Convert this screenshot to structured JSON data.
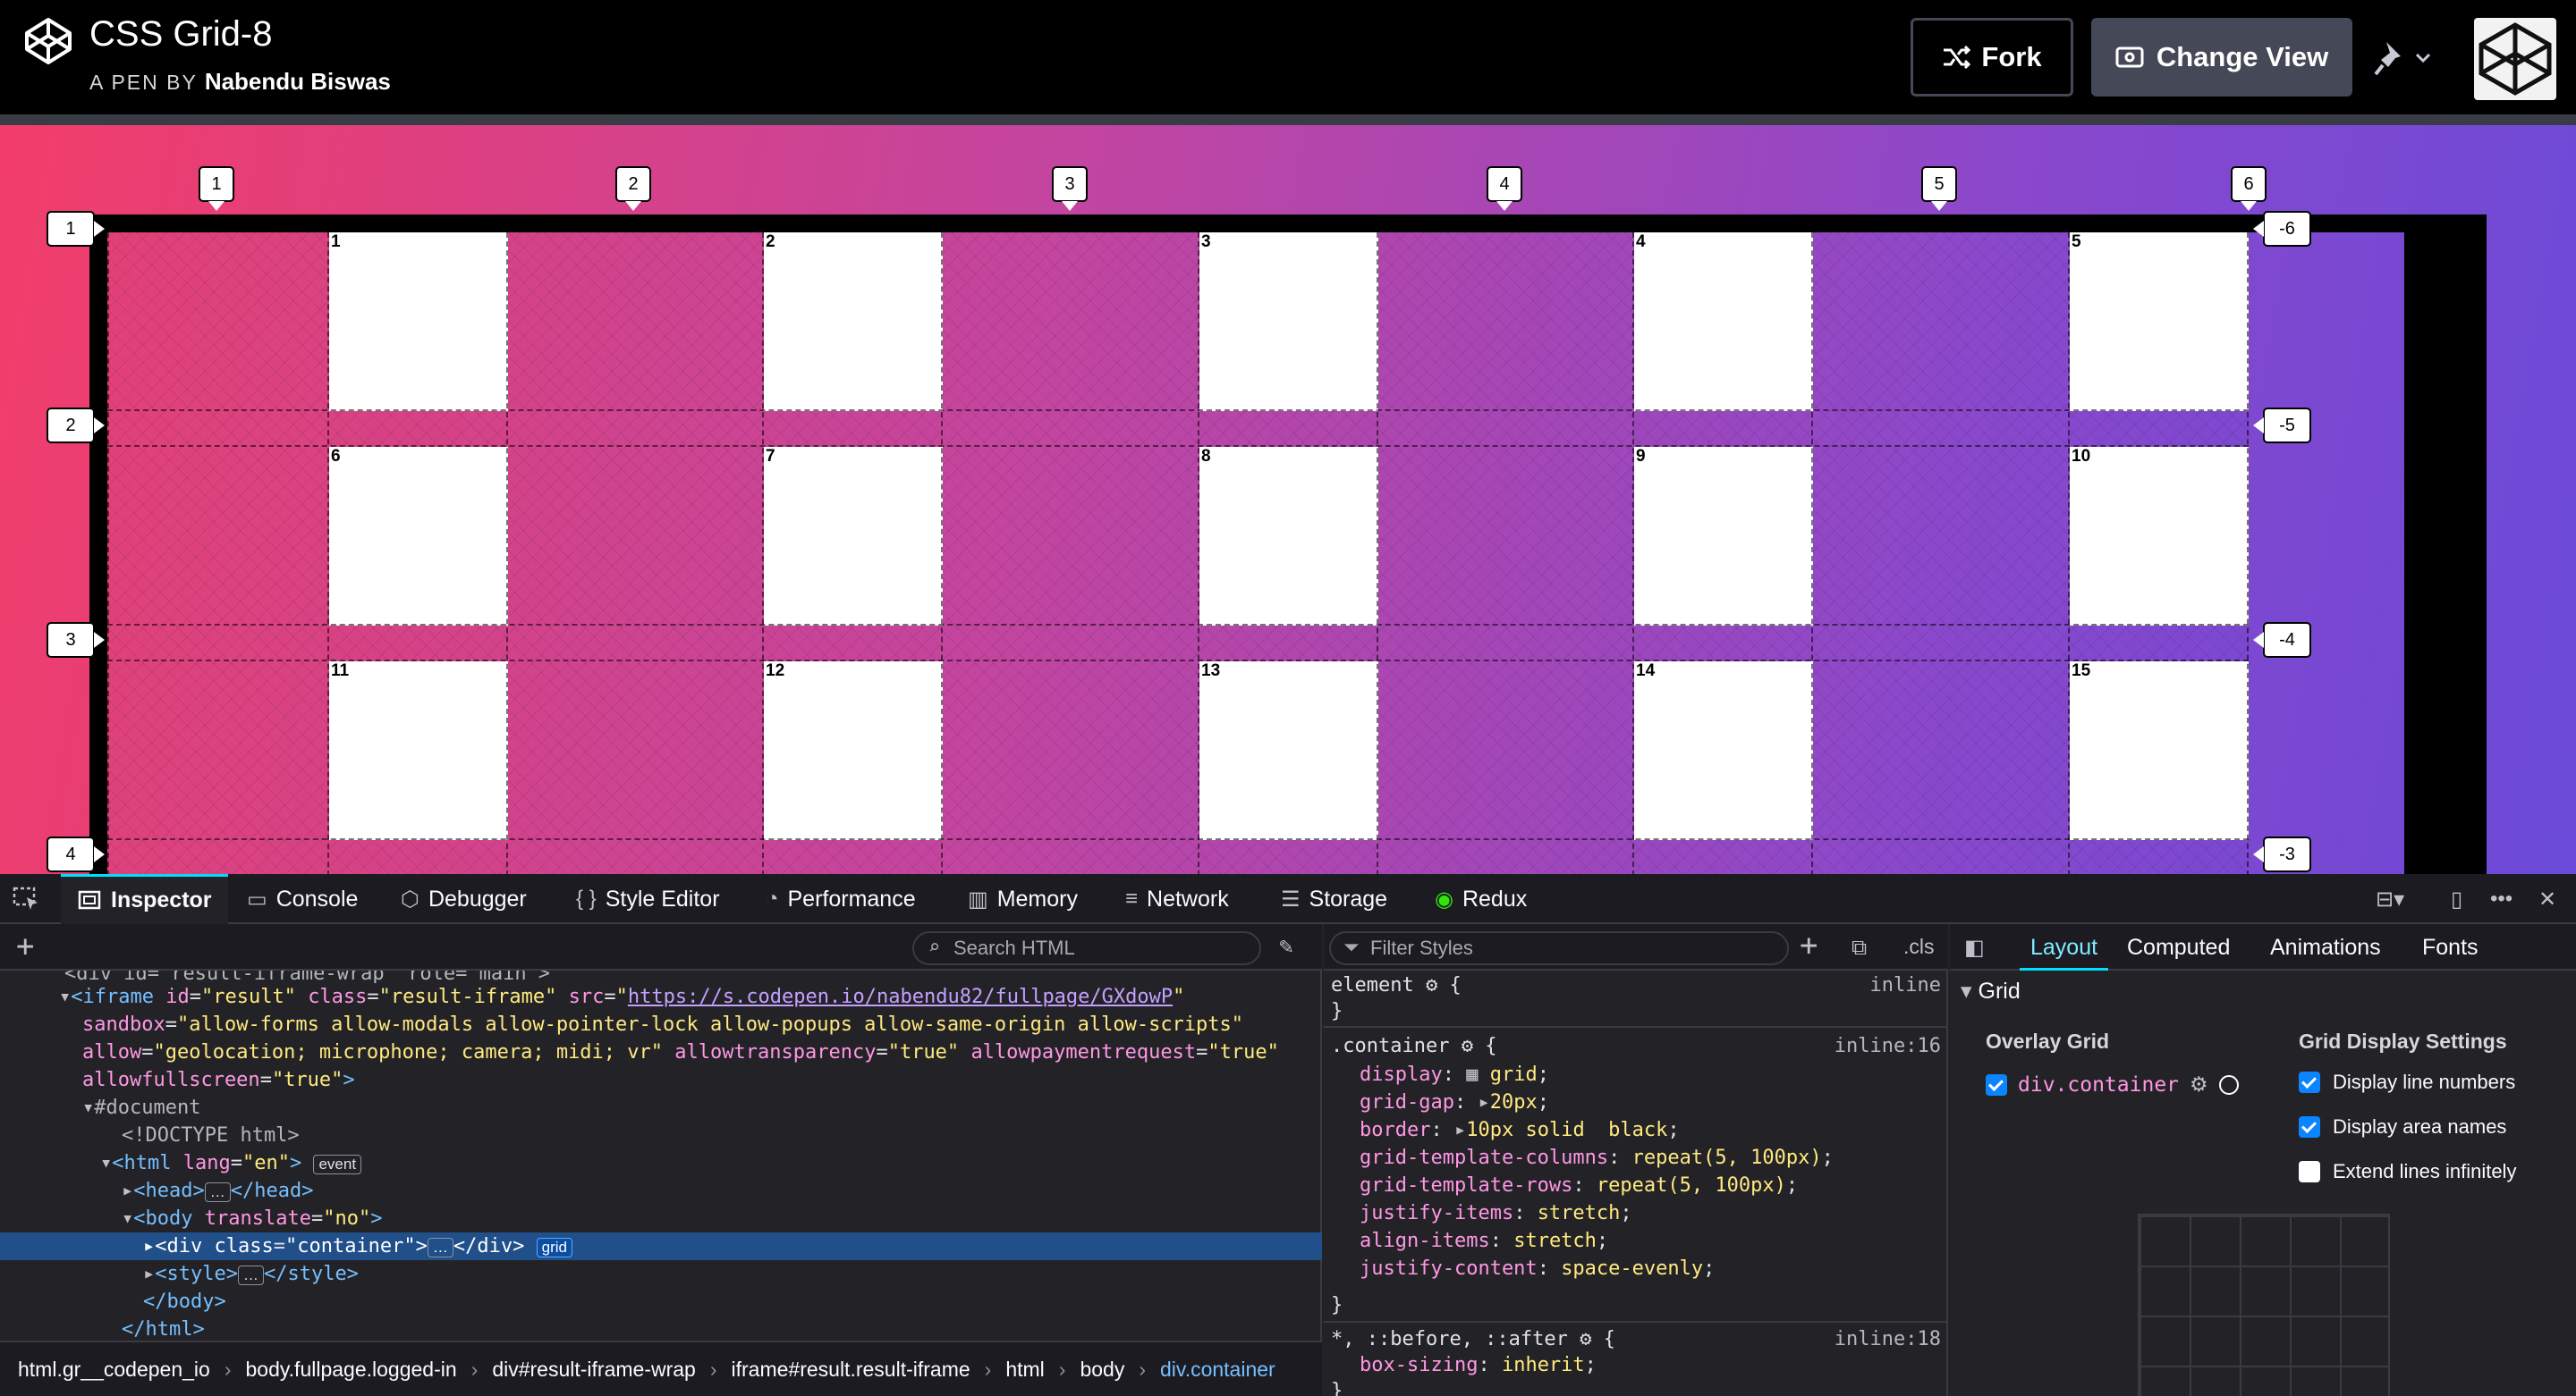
{
  "header": {
    "pen_title": "CSS Grid-8",
    "pen_by": "A PEN BY",
    "author": "Nabendu Biswas",
    "fork_label": "Fork",
    "change_view_label": "Change View"
  },
  "preview": {
    "top_line_numbers": [
      "1",
      "2",
      "3",
      "4",
      "5",
      "6"
    ],
    "left_line_numbers": [
      "1",
      "2",
      "3",
      "4"
    ],
    "right_line_numbers": [
      "-6",
      "-5",
      "-4",
      "-3"
    ],
    "cells": [
      "1",
      "2",
      "3",
      "4",
      "5",
      "6",
      "7",
      "8",
      "9",
      "10",
      "11",
      "12",
      "13",
      "14",
      "15"
    ]
  },
  "devtools": {
    "tabs": [
      "Inspector",
      "Console",
      "Debugger",
      "Style Editor",
      "Performance",
      "Memory",
      "Network",
      "Storage",
      "Redux"
    ],
    "search_html_placeholder": "Search HTML",
    "filter_styles_placeholder": "Filter Styles",
    "cls_label": ".cls",
    "markup": {
      "line0": "<div id=\"result-iframe-wrap\" role=\"main\">",
      "iframe_id": "\"result\"",
      "iframe_class": "\"result-iframe\"",
      "iframe_src": "https://s.codepen.io/nabendu82/fullpage/GXdowP",
      "sandbox": "\"allow-forms allow-modals allow-pointer-lock allow-popups allow-same-origin allow-scripts\"",
      "allow": "\"geolocation; microphone; camera; midi; vr\"",
      "allowtransparency": "\"true\"",
      "allowpaymentrequest": "\"true\"",
      "allowfullscreen": "\"true\"",
      "document": "#document",
      "doctype": "<!DOCTYPE html>",
      "html_lang": "\"en\"",
      "event_badge": "event",
      "grid_badge": "grid",
      "body_translate": "\"no\"",
      "div_class": "\"container\""
    },
    "breadcrumbs": [
      "html.gr__codepen_io",
      "body.fullpage.logged-in",
      "div#result-iframe-wrap",
      "iframe#result.result-iframe",
      "html",
      "body",
      "div.container"
    ],
    "rules": {
      "element_selector": "element",
      "element_source": "inline",
      "container_selector": ".container",
      "container_source": "inline:16",
      "decls": [
        {
          "p": "display",
          "v": "grid"
        },
        {
          "p": "grid-gap",
          "v": "20px"
        },
        {
          "p": "border",
          "v": "10px solid  black"
        },
        {
          "p": "grid-template-columns",
          "v": "repeat(5, 100px)"
        },
        {
          "p": "grid-template-rows",
          "v": "repeat(5, 100px)"
        },
        {
          "p": "justify-items",
          "v": "stretch"
        },
        {
          "p": "align-items",
          "v": "stretch"
        },
        {
          "p": "justify-content",
          "v": "space-evenly"
        }
      ],
      "universal_selector": "*, ::before, ::after",
      "universal_source": "inline:18",
      "universal_decl": {
        "p": "box-sizing",
        "v": "inherit"
      }
    },
    "layout": {
      "tabs": [
        "Layout",
        "Computed",
        "Animations",
        "Fonts"
      ],
      "section": "Grid",
      "overlay_grid": "Overlay Grid",
      "grid_item": "div.container",
      "display_settings": "Grid Display Settings",
      "settings": [
        {
          "label": "Display line numbers",
          "checked": true
        },
        {
          "label": "Display area names",
          "checked": true
        },
        {
          "label": "Extend lines infinitely",
          "checked": false
        }
      ]
    }
  }
}
